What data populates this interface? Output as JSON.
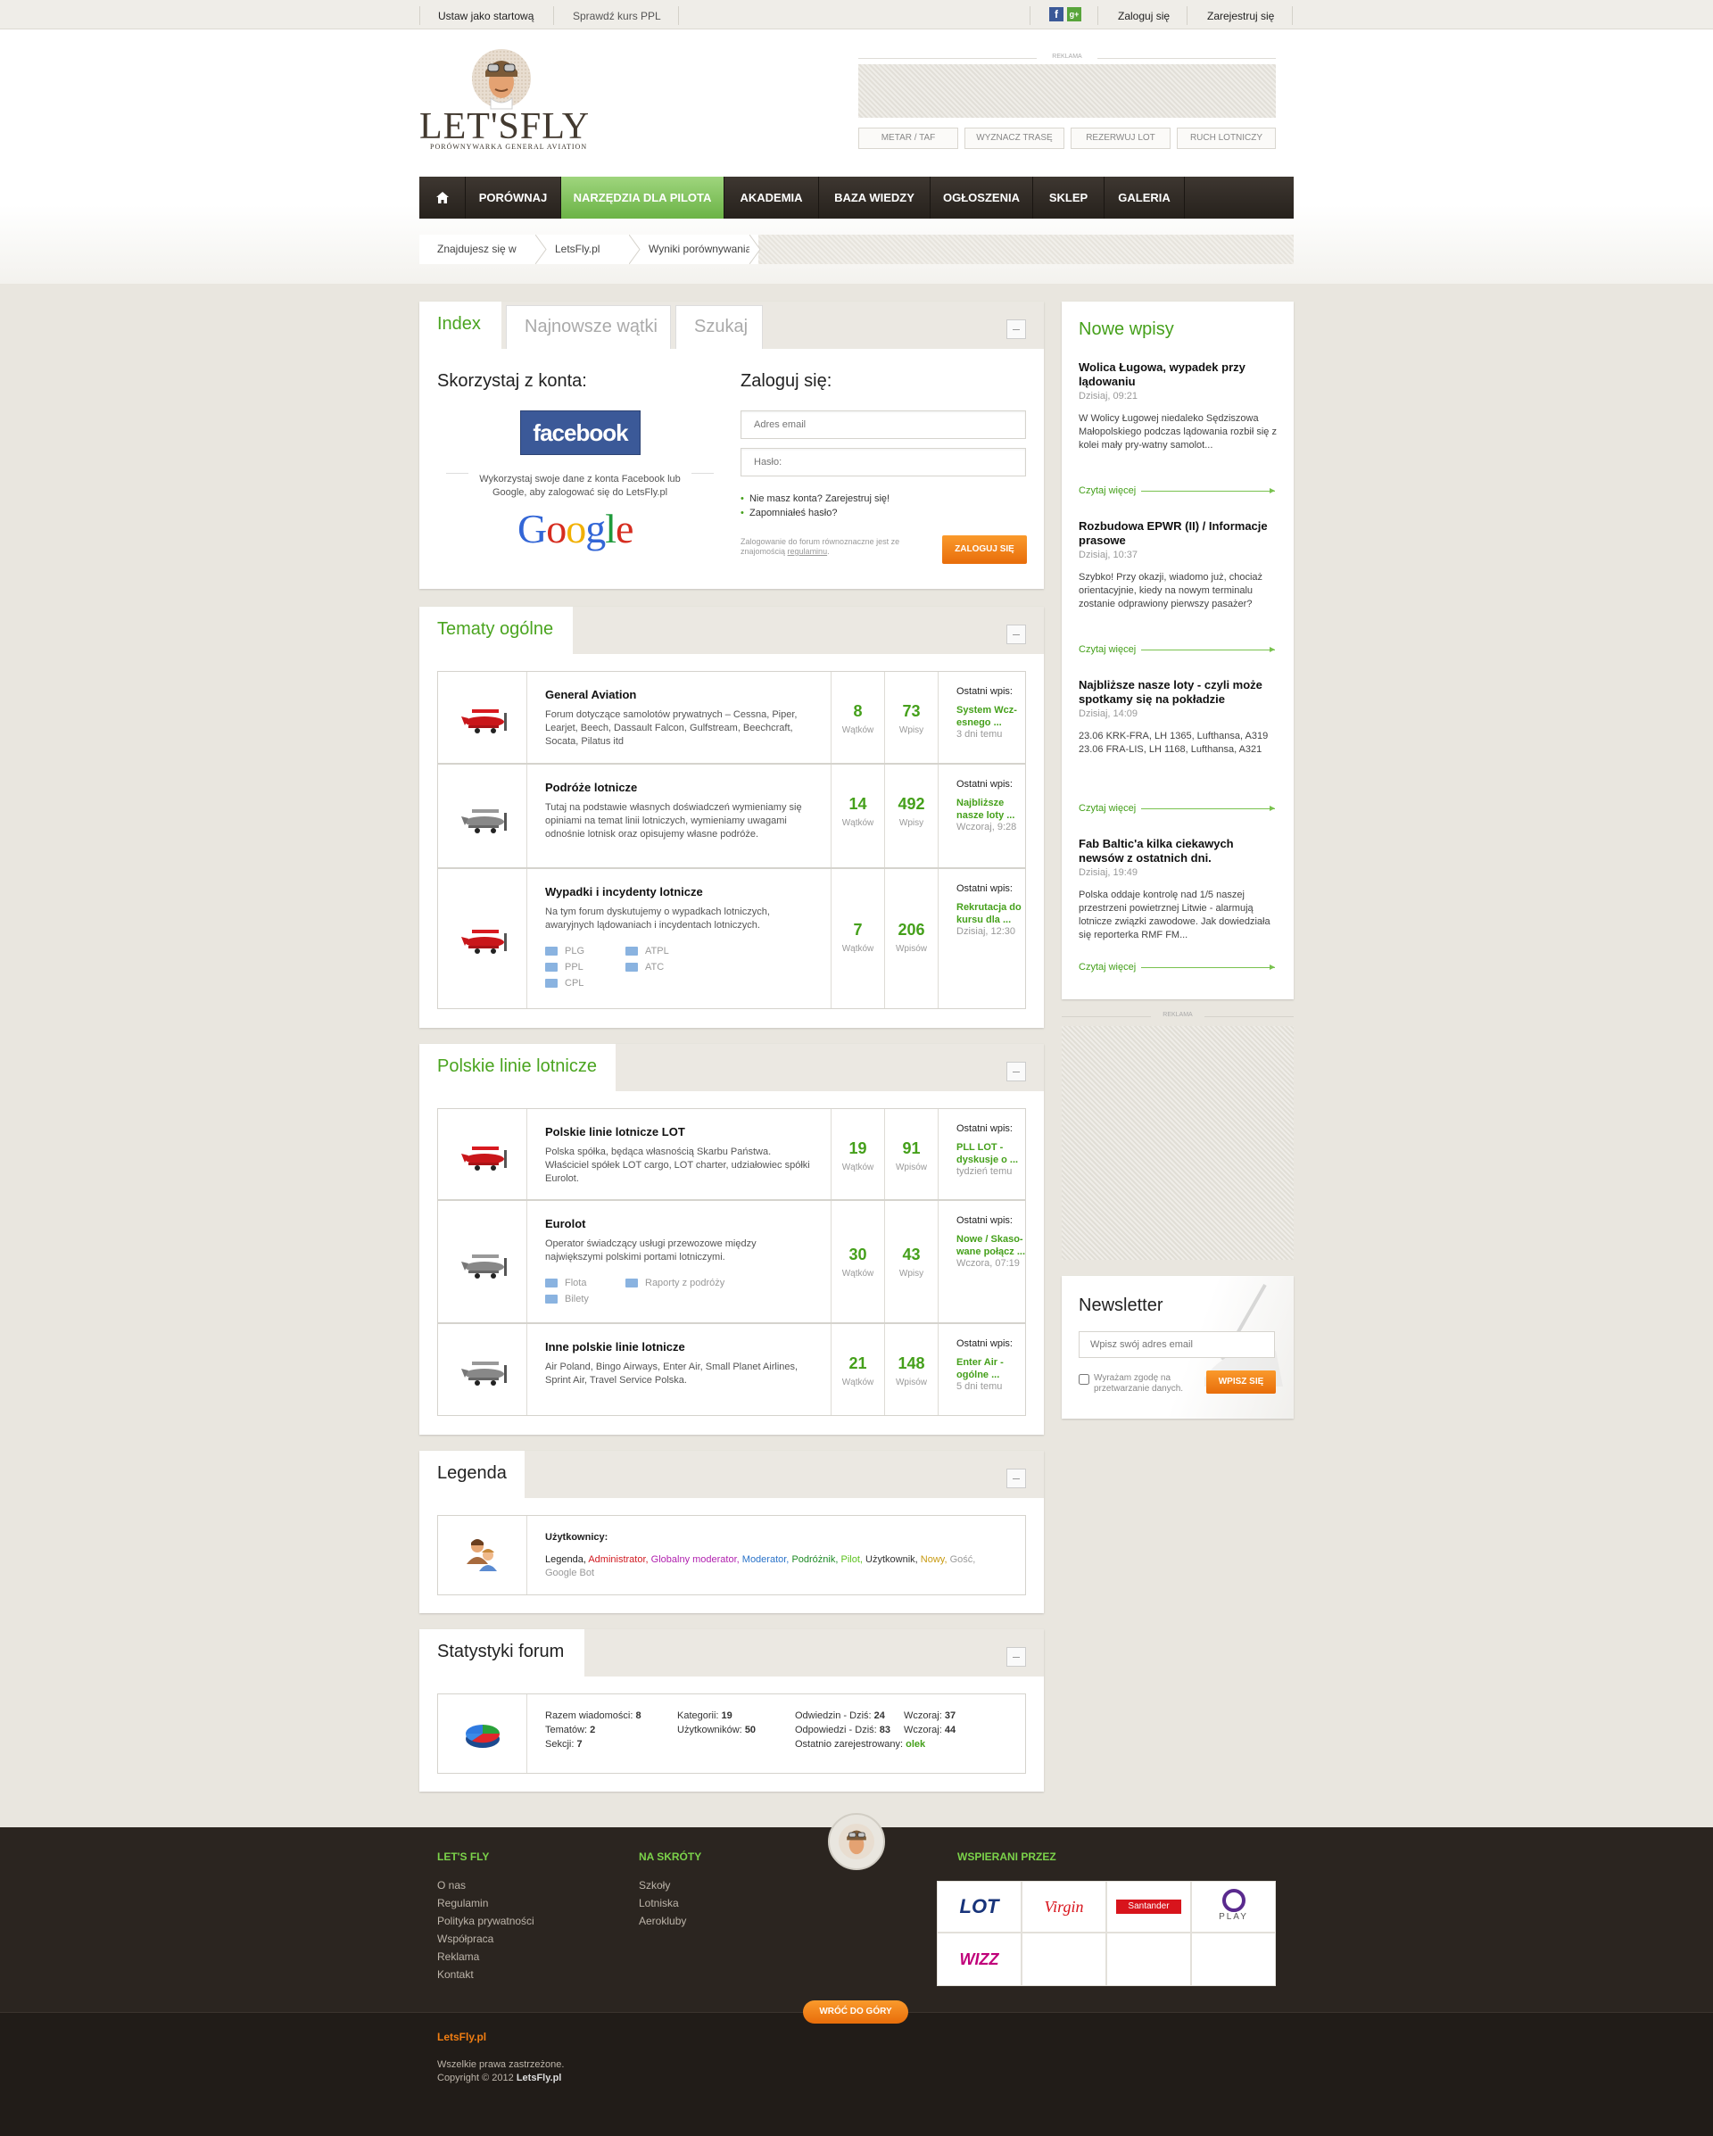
{
  "topbar": {
    "set_home": "Ustaw jako startową",
    "check_ppl": "Sprawdź kurs PPL",
    "login": "Zaloguj się",
    "register": "Zarejestruj się"
  },
  "header": {
    "logo_text": "LET'SFLY",
    "logo_tagline": "PORÓWNYWARKA GENERAL AVIATION",
    "ad_label": "REKLAMA",
    "tools": [
      "METAR / TAF",
      "WYZNACZ TRASĘ",
      "REZERWUJ LOT",
      "RUCH LOTNICZY"
    ]
  },
  "nav": {
    "items": [
      "PORÓWNAJ",
      "NARZĘDZIA DLA PILOTA",
      "AKADEMIA",
      "BAZA WIEDZY",
      "OGŁOSZENIA",
      "SKLEP",
      "GALERIA"
    ],
    "active": "NARZĘDZIA DLA PILOTA"
  },
  "breadcrumb": [
    "Znajdujesz się w",
    "LetsFly.pl",
    "Wyniki porównywania"
  ],
  "login_panel": {
    "tabs": [
      "Index",
      "Najnowsze wątki",
      "Szukaj"
    ],
    "social_title": "Skorzystaj z konta:",
    "facebook": "facebook",
    "social_desc": "Wykorzystaj swoje dane z konta Facebook lub Google, aby zalogować się do LetsFly.pl",
    "google": "Google",
    "login_title": "Zaloguj się:",
    "email_placeholder": "Adres email",
    "password_placeholder": "Hasło:",
    "no_account": "Nie masz konta? Zarejestruj się!",
    "forgot": "Zapomniałeś hasło?",
    "terms_note": "Zalogowanie do forum równoznaczne jest ze znajomością",
    "terms_link": "regulaminu",
    "login_button": "ZALOGUJ SIĘ"
  },
  "general_topics": {
    "title": "Tematy ogólne",
    "rows": [
      {
        "title": "General Aviation",
        "desc": "Forum dotyczące samolotów prywatnych – Cessna, Piper, Learjet, Beech, Dassault Falcon, Gulfstream, Beechcraft, Socata, Pilatus itd",
        "threads": "8",
        "threads_label": "Wątków",
        "posts": "73",
        "posts_label": "Wpisy",
        "last_label": "Ostatni wpis:",
        "last_title": "System Wcz-esnego ...",
        "last_time": "3 dni temu",
        "subs": []
      },
      {
        "title": "Podróże lotnicze",
        "desc": "Tutaj na podstawie własnych doświadczeń wymieniamy się opiniami na temat linii lotniczych, wymieniamy uwagami odnośnie lotnisk oraz opisujemy własne podróże.",
        "threads": "14",
        "threads_label": "Wątków",
        "posts": "492",
        "posts_label": "Wpisy",
        "last_label": "Ostatni wpis:",
        "last_title": "Najbliższe nasze loty ...",
        "last_time": "Wczoraj, 9:28",
        "subs": []
      },
      {
        "title": "Wypadki i incydenty lotnicze",
        "desc": "Na tym forum dyskutujemy o wypadkach lotniczych, awaryjnych lądowaniach i incydentach lotniczych.",
        "threads": "7",
        "threads_label": "Wątków",
        "posts": "206",
        "posts_label": "Wpisów",
        "last_label": "Ostatni wpis:",
        "last_title": "Rekrutacja do kursu dla ...",
        "last_time": "Dzisiaj, 12:30",
        "subs": [
          "PLG",
          "ATPL",
          "PPL",
          "ATC",
          "CPL"
        ]
      }
    ]
  },
  "polish_airlines": {
    "title": "Polskie linie lotnicze",
    "rows": [
      {
        "title": "Polskie linie lotnicze LOT",
        "desc": "Polska spółka, będąca własnością Skarbu Państwa. Właściciel spółek LOT cargo, LOT charter, udziałowiec spółki Eurolot.",
        "threads": "19",
        "threads_label": "Wątków",
        "posts": "91",
        "posts_label": "Wpisów",
        "last_label": "Ostatni wpis:",
        "last_title": "PLL LOT - dyskusje o ...",
        "last_time": "tydzień temu"
      },
      {
        "title": "Eurolot",
        "desc": "Operator świadczący usługi przewozowe między największymi polskimi portami lotniczymi.",
        "threads": "30",
        "threads_label": "Wątków",
        "posts": "43",
        "posts_label": "Wpisy",
        "last_label": "Ostatni wpis:",
        "last_title": "Nowe / Skaso-wane połącz ...",
        "last_time": "Wczora, 07:19",
        "subs": [
          "Flota",
          "Raporty z podróży",
          "Bilety"
        ]
      },
      {
        "title": "Inne polskie linie lotnicze",
        "desc": "Air Poland, Bingo Airways, Enter Air, Small Planet Airlines, Sprint Air, Travel Service Polska.",
        "threads": "21",
        "threads_label": "Wątków",
        "posts": "148",
        "posts_label": "Wpisów",
        "last_label": "Ostatni wpis:",
        "last_title": "Enter Air - ogólne ...",
        "last_time": "5 dni temu"
      }
    ]
  },
  "legend": {
    "title": "Legenda",
    "users_label": "Użytkownicy:",
    "roles": [
      {
        "name": "Legenda,",
        "color": "#222222"
      },
      {
        "name": "Administrator,",
        "color": "#d0181f"
      },
      {
        "name": "Globalny moderator,",
        "color": "#b01fae"
      },
      {
        "name": "Moderator,",
        "color": "#2a73c9"
      },
      {
        "name": "Podróżnik,",
        "color": "#1e8a25"
      },
      {
        "name": "Pilot,",
        "color": "#5cc21f"
      },
      {
        "name": "Użytkownik,",
        "color": "#333333"
      },
      {
        "name": "Nowy,",
        "color": "#c89a11"
      },
      {
        "name": "Gość,",
        "color": "#999999"
      },
      {
        "name": "Google Bot",
        "color": "#999999"
      }
    ]
  },
  "stats": {
    "title": "Statystyki forum",
    "col1": [
      {
        "label": "Razem wiadomości:",
        "value": "8"
      },
      {
        "label": "Tematów:",
        "value": "2"
      },
      {
        "label": "Sekcji:",
        "value": "7"
      }
    ],
    "col2": [
      {
        "label": "Kategorii:",
        "value": "19"
      },
      {
        "label": "Użytkowników:",
        "value": "50"
      }
    ],
    "col3": [
      {
        "label": "Odwiedzin - Dziś:",
        "value": "24"
      },
      {
        "label": "Odpowiedzi - Dziś:",
        "value": "83"
      }
    ],
    "col4": [
      {
        "label": "Wczoraj:",
        "value": "37"
      },
      {
        "label": "Wczoraj:",
        "value": "44"
      }
    ],
    "last_registered_label": "Ostatnio zarejestrowany:",
    "last_registered": "olek"
  },
  "sidebar": {
    "title": "Nowe wpisy",
    "posts": [
      {
        "title": "Wolica Ługowa, wypadek przy lądowaniu",
        "date": "Dzisiaj, 09:21",
        "text": "W Wolicy Ługowej niedaleko Sędziszowa Małopolskiego podczas lądowania rozbił się z kolei mały pry-watny samolot...",
        "more": "Czytaj więcej"
      },
      {
        "title": "Rozbudowa EPWR (II) / Informacje prasowe",
        "date": "Dzisiaj, 10:37",
        "text": "Szybko! Przy okazji, wiadomo już, chociaż orientacyjnie, kiedy na nowym terminalu zostanie odprawiony pierwszy pasażer?",
        "more": "Czytaj więcej"
      },
      {
        "title": "Najbliższe nasze loty - czyli może spotkamy się na pokładzie",
        "date": "Dzisiaj, 14:09",
        "text": "23.06 KRK-FRA, LH 1365, Lufthansa, A319\n23.06 FRA-LIS, LH 1168, Lufthansa, A321",
        "more": "Czytaj więcej"
      },
      {
        "title": "Fab Baltic'a kilka ciekawych newsów z ostatnich dni.",
        "date": "Dzisiaj, 19:49",
        "text": "Polska oddaje kontrolę nad 1/5 naszej przestrzeni powietrznej Litwie - alarmują lotnicze związki zawodowe. Jak dowiedziała się reporterka RMF FM...",
        "more": "Czytaj więcej"
      }
    ],
    "ad_label": "REKLAMA",
    "newsletter": {
      "title": "Newsletter",
      "placeholder": "Wpisz swój adres email",
      "consent": "Wyrażam zgodę na przetwarzanie danych.",
      "button": "WPISZ SIĘ"
    }
  },
  "footer": {
    "col1_title": "LET'S FLY",
    "col1_links": [
      "O nas",
      "Regulamin",
      "Polityka prywatności",
      "Współpraca",
      "Reklama",
      "Kontakt"
    ],
    "col2_title": "NA SKRÓTY",
    "col2_links": [
      "Szkoły",
      "Lotniska",
      "Aerokluby"
    ],
    "col3_title": "WSPIERANI PRZEZ",
    "sponsors": [
      "LOT",
      "Virgin",
      "Santander",
      "PLAY",
      "WIZZ"
    ],
    "back_to_top": "WRÓĆ DO GÓRY",
    "brand": "LetsFly.pl",
    "rights": "Wszelkie prawa zastrzeżone.",
    "copyright_prefix": "Copyright © 2012",
    "copyright_brand": "LetsFly.pl"
  },
  "colors": {
    "accent_green": "#45a01b",
    "nav_dark": "#2e2823",
    "orange": "#f07d12",
    "footer_bg": "#2b2520"
  }
}
